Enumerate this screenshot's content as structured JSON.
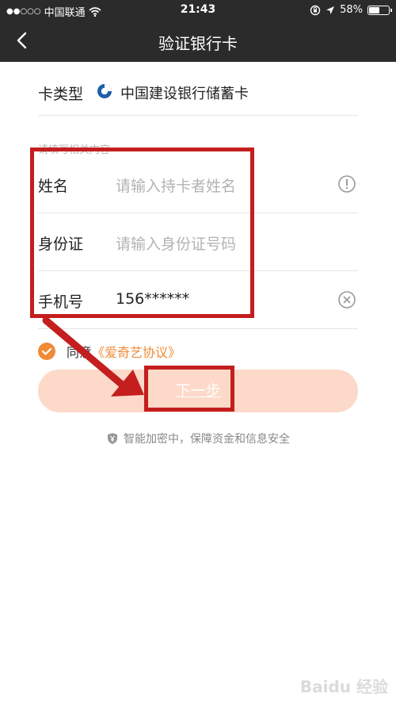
{
  "status_bar": {
    "carrier": "中国联通",
    "time": "21:43",
    "battery": "58%",
    "battery_level": 0.58
  },
  "nav": {
    "title": "验证银行卡"
  },
  "card_type": {
    "label": "卡类型",
    "bank": "中国建设银行储蓄卡"
  },
  "hint": "请填写相关内容",
  "form": {
    "name": {
      "label": "姓名",
      "placeholder": "请输入持卡者姓名"
    },
    "id_number": {
      "label": "身份证",
      "placeholder": "请输入身份证号码"
    },
    "phone": {
      "label": "手机号",
      "value": "156******"
    }
  },
  "agreement": {
    "text": "同意",
    "link": "《爱奇艺协议》"
  },
  "next_button": "下一步",
  "security_note": "智能加密中，保障资金和信息安全",
  "colors": {
    "accent": "#f08a36",
    "button_bg": "#fcd9c8",
    "nav_bg": "#2b2b2b",
    "annotation": "#c41e1e"
  }
}
